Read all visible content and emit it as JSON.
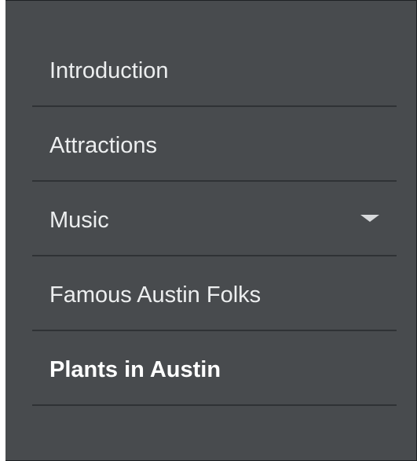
{
  "nav": {
    "items": [
      {
        "label": "Introduction",
        "active": false,
        "has_submenu": false
      },
      {
        "label": "Attractions",
        "active": false,
        "has_submenu": false
      },
      {
        "label": "Music",
        "active": false,
        "has_submenu": true
      },
      {
        "label": "Famous Austin Folks",
        "active": false,
        "has_submenu": false
      },
      {
        "label": "Plants in Austin",
        "active": true,
        "has_submenu": false
      }
    ]
  },
  "colors": {
    "background": "#484b4e",
    "divider": "#2f3235",
    "text": "#eceeef"
  },
  "icons": {
    "submenu": "chevron-down-icon"
  }
}
